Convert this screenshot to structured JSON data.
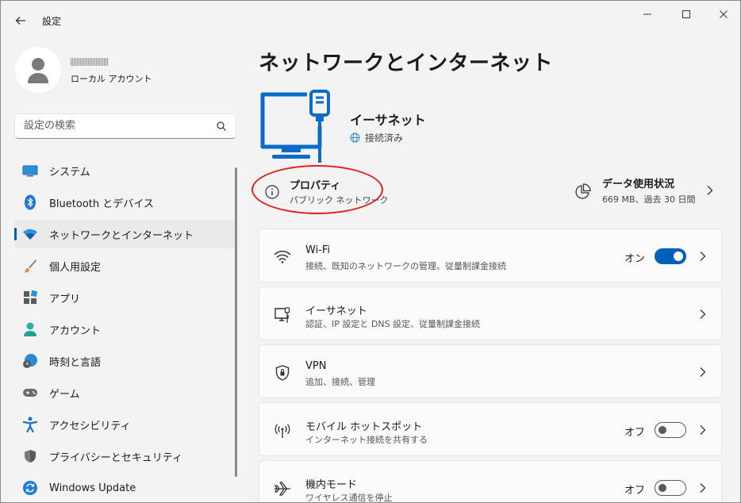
{
  "window": {
    "title": "設定"
  },
  "profile": {
    "account_type": "ローカル アカウント"
  },
  "search": {
    "placeholder": "設定の検索"
  },
  "sidebar": {
    "items": [
      {
        "label": "システム",
        "icon": "system-icon"
      },
      {
        "label": "Bluetooth とデバイス",
        "icon": "bluetooth-icon"
      },
      {
        "label": "ネットワークとインターネット",
        "icon": "wifi-icon",
        "active": true
      },
      {
        "label": "個人用設定",
        "icon": "brush-icon"
      },
      {
        "label": "アプリ",
        "icon": "apps-icon"
      },
      {
        "label": "アカウント",
        "icon": "account-icon"
      },
      {
        "label": "時刻と言語",
        "icon": "time-language-icon"
      },
      {
        "label": "ゲーム",
        "icon": "gamepad-icon"
      },
      {
        "label": "アクセシビリティ",
        "icon": "accessibility-icon"
      },
      {
        "label": "プライバシーとセキュリティ",
        "icon": "shield-icon"
      },
      {
        "label": "Windows Update",
        "icon": "update-icon"
      }
    ]
  },
  "main": {
    "page_title": "ネットワークとインターネット",
    "connection": {
      "name": "イーサネット",
      "status": "接続済み"
    },
    "properties": {
      "title": "プロパティ",
      "subtitle": "パブリック ネットワーク"
    },
    "data_usage": {
      "title": "データ使用状況",
      "subtitle": "669 MB、過去 30 日間"
    },
    "cards": [
      {
        "title": "Wi-Fi",
        "subtitle": "接続、既知のネットワークの管理、従量制課金接続",
        "state": "オン",
        "toggle": "on",
        "icon": "wifi-icon"
      },
      {
        "title": "イーサネット",
        "subtitle": "認証、IP 設定と DNS 設定、従量制課金接続",
        "icon": "ethernet-icon"
      },
      {
        "title": "VPN",
        "subtitle": "追加、接続、管理",
        "icon": "vpn-shield-icon"
      },
      {
        "title": "モバイル ホットスポット",
        "subtitle": "インターネット接続を共有する",
        "state": "オフ",
        "toggle": "off",
        "icon": "hotspot-icon"
      },
      {
        "title": "機内モード",
        "subtitle": "ワイヤレス通信を停止",
        "state": "オフ",
        "toggle": "off",
        "icon": "airplane-icon"
      }
    ]
  },
  "colors": {
    "accent": "#005fb8",
    "annotation": "#e02020",
    "hero": "#0a6cc8"
  }
}
